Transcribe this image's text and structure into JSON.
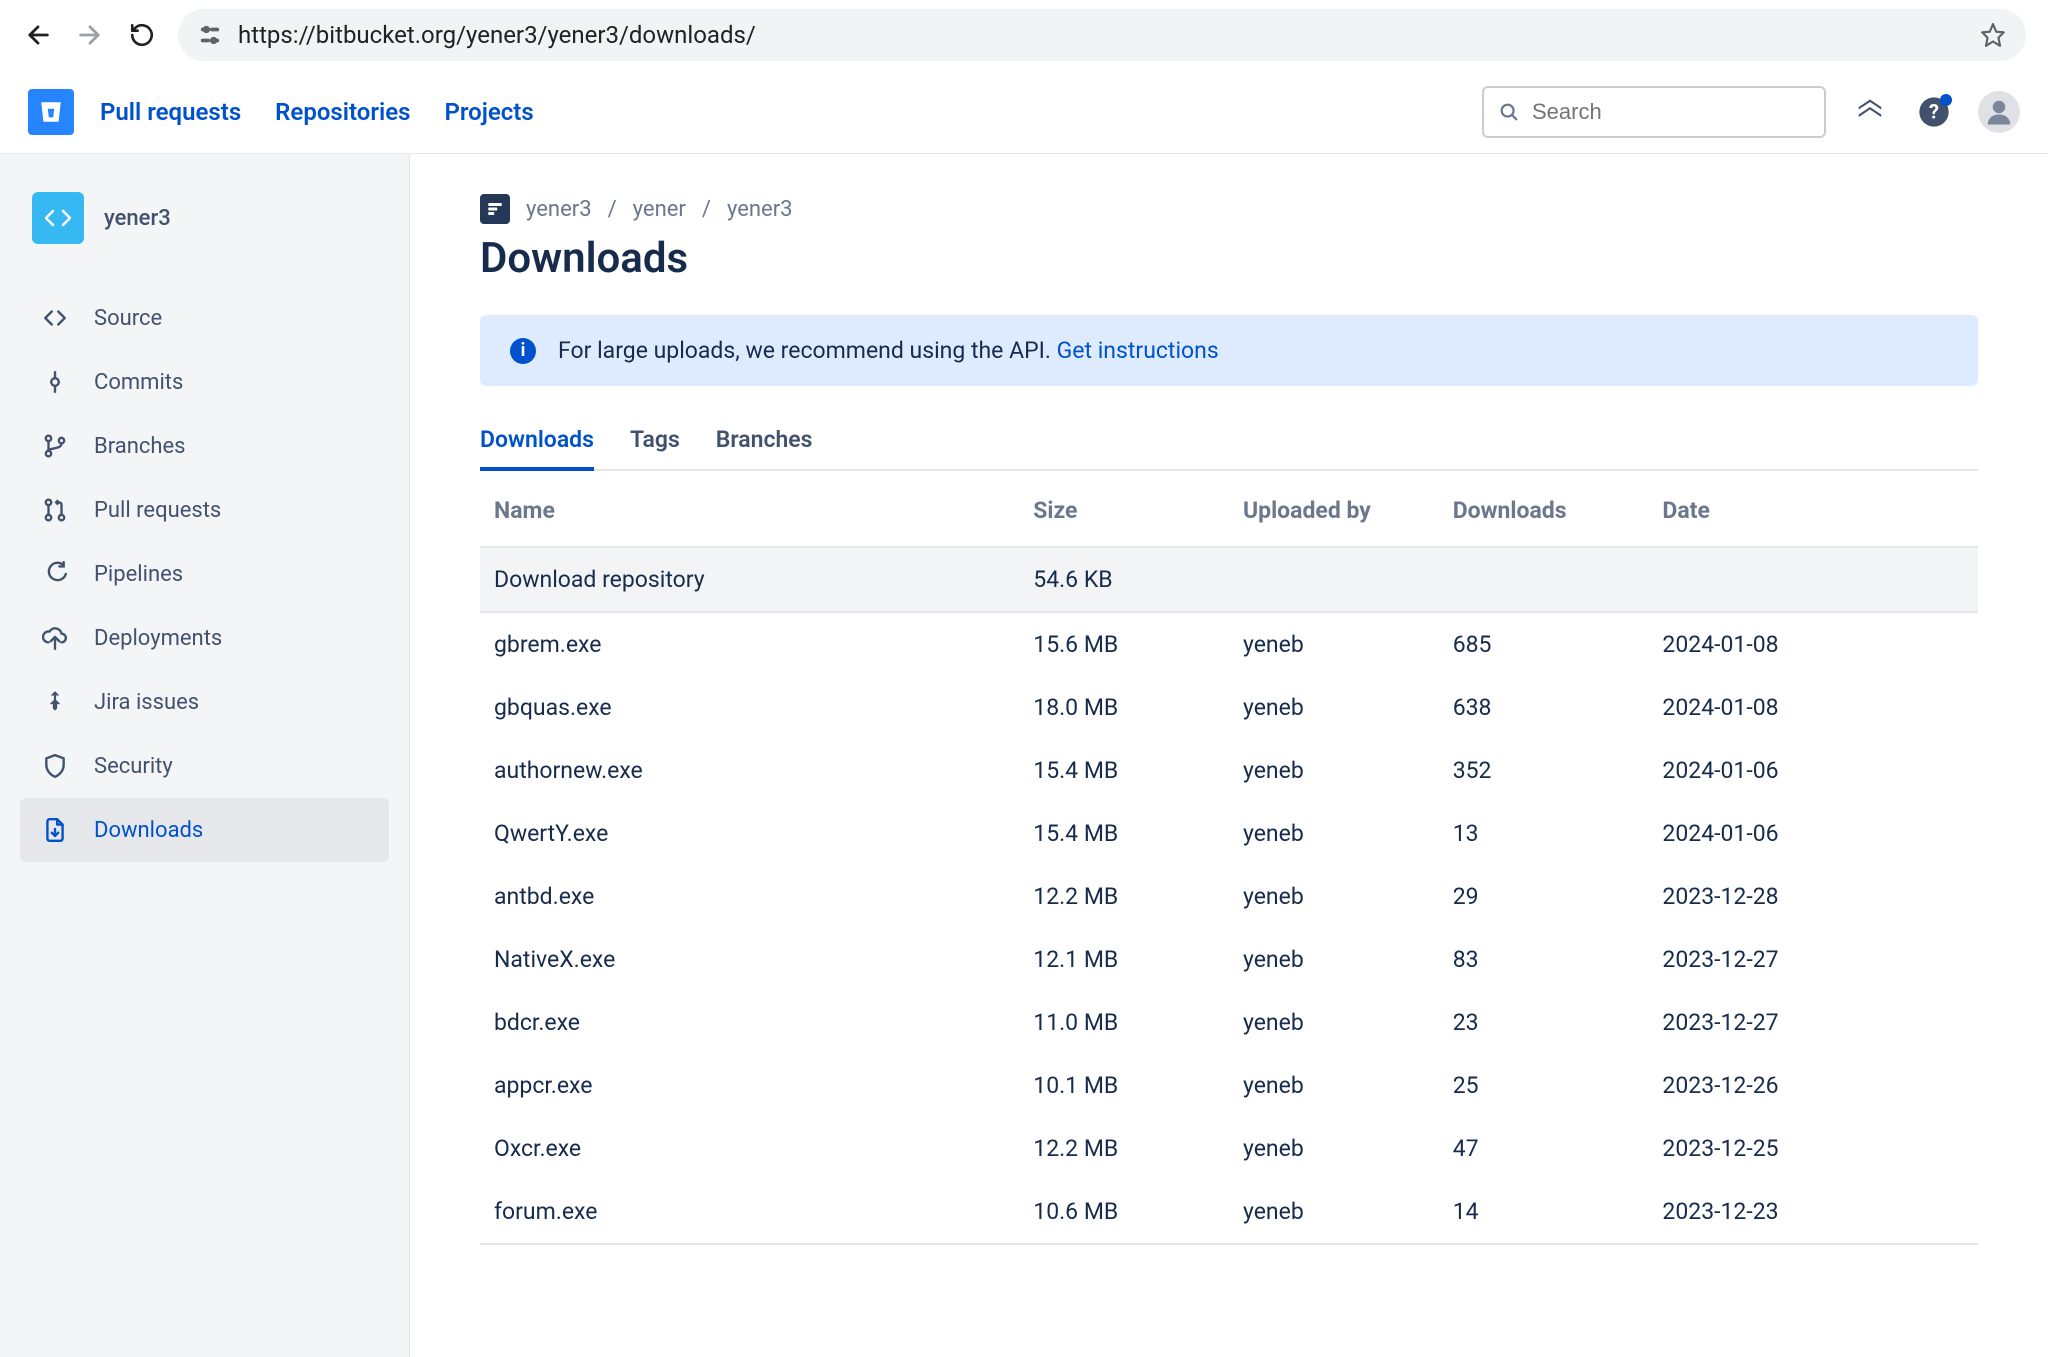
{
  "browser": {
    "url": "https://bitbucket.org/yener3/yener3/downloads/"
  },
  "header": {
    "nav": [
      "Pull requests",
      "Repositories",
      "Projects"
    ],
    "search_placeholder": "Search"
  },
  "sidebar": {
    "repo_name": "yener3",
    "items": [
      {
        "label": "Source",
        "icon": "code-icon"
      },
      {
        "label": "Commits",
        "icon": "commit-icon"
      },
      {
        "label": "Branches",
        "icon": "branch-icon"
      },
      {
        "label": "Pull requests",
        "icon": "pull-request-icon"
      },
      {
        "label": "Pipelines",
        "icon": "pipelines-icon"
      },
      {
        "label": "Deployments",
        "icon": "deployments-icon"
      },
      {
        "label": "Jira issues",
        "icon": "jira-icon"
      },
      {
        "label": "Security",
        "icon": "security-icon"
      },
      {
        "label": "Downloads",
        "icon": "download-icon"
      }
    ],
    "active_index": 8
  },
  "breadcrumb": [
    "yener3",
    "yener",
    "yener3"
  ],
  "page_title": "Downloads",
  "banner": {
    "text": "For large uploads, we recommend using the API. ",
    "link_text": "Get instructions"
  },
  "tabs": [
    "Downloads",
    "Tags",
    "Branches"
  ],
  "active_tab": 0,
  "table": {
    "headers": [
      "Name",
      "Size",
      "Uploaded by",
      "Downloads",
      "Date"
    ],
    "repo_row": {
      "name": "Download repository",
      "size": "54.6 KB"
    },
    "rows": [
      {
        "name": "gbrem.exe",
        "size": "15.6 MB",
        "uploaded_by": "yeneb",
        "downloads": "685",
        "date": "2024-01-08"
      },
      {
        "name": "gbquas.exe",
        "size": "18.0 MB",
        "uploaded_by": "yeneb",
        "downloads": "638",
        "date": "2024-01-08"
      },
      {
        "name": "authornew.exe",
        "size": "15.4 MB",
        "uploaded_by": "yeneb",
        "downloads": "352",
        "date": "2024-01-06"
      },
      {
        "name": "QwertY.exe",
        "size": "15.4 MB",
        "uploaded_by": "yeneb",
        "downloads": "13",
        "date": "2024-01-06"
      },
      {
        "name": "antbd.exe",
        "size": "12.2 MB",
        "uploaded_by": "yeneb",
        "downloads": "29",
        "date": "2023-12-28"
      },
      {
        "name": "NativeX.exe",
        "size": "12.1 MB",
        "uploaded_by": "yeneb",
        "downloads": "83",
        "date": "2023-12-27"
      },
      {
        "name": "bdcr.exe",
        "size": "11.0 MB",
        "uploaded_by": "yeneb",
        "downloads": "23",
        "date": "2023-12-27"
      },
      {
        "name": "appcr.exe",
        "size": "10.1 MB",
        "uploaded_by": "yeneb",
        "downloads": "25",
        "date": "2023-12-26"
      },
      {
        "name": "Oxcr.exe",
        "size": "12.2 MB",
        "uploaded_by": "yeneb",
        "downloads": "47",
        "date": "2023-12-25"
      },
      {
        "name": "forum.exe",
        "size": "10.6 MB",
        "uploaded_by": "yeneb",
        "downloads": "14",
        "date": "2023-12-23"
      }
    ]
  }
}
